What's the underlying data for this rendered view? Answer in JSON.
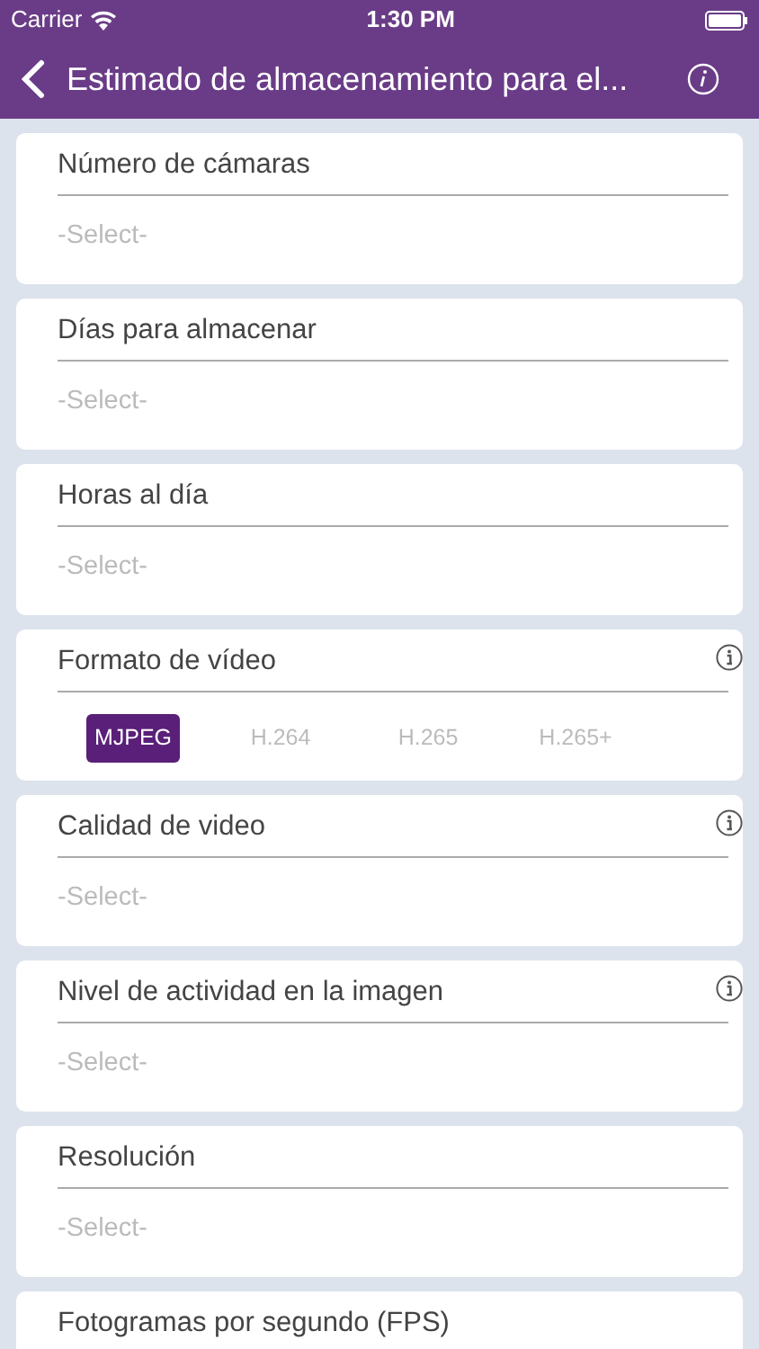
{
  "status_bar": {
    "carrier": "Carrier",
    "time": "1:30 PM"
  },
  "nav_bar": {
    "title": "Estimado de almacenamiento para el..."
  },
  "fields": [
    {
      "kind": "select",
      "label": "Número de cámaras",
      "info": false,
      "placeholder": "-Select-"
    },
    {
      "kind": "select",
      "label": "Días para almacenar",
      "info": false,
      "placeholder": "-Select-"
    },
    {
      "kind": "select",
      "label": "Horas al día",
      "info": false,
      "placeholder": "-Select-"
    },
    {
      "kind": "segmented",
      "label": "Formato de vídeo",
      "info": true,
      "options": [
        {
          "label": "MJPEG",
          "selected": true
        },
        {
          "label": "H.264",
          "selected": false
        },
        {
          "label": "H.265",
          "selected": false
        },
        {
          "label": "H.265+",
          "selected": false
        }
      ]
    },
    {
      "kind": "select",
      "label": "Calidad de video",
      "info": true,
      "placeholder": "-Select-"
    },
    {
      "kind": "select",
      "label": "Nivel de actividad en la imagen",
      "info": true,
      "placeholder": "-Select-"
    },
    {
      "kind": "select",
      "label": "Resolución",
      "info": false,
      "placeholder": "-Select-"
    },
    {
      "kind": "select",
      "label": "Fotogramas por segundo (FPS)",
      "info": false
    }
  ]
}
